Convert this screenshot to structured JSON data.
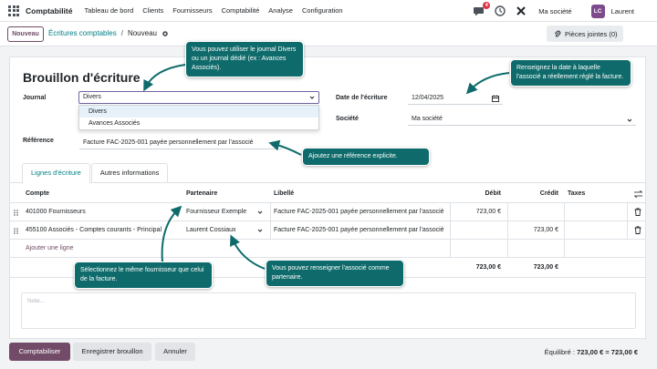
{
  "topbar": {
    "brand": "Comptabilité",
    "menu": [
      "Tableau de bord",
      "Clients",
      "Fournisseurs",
      "Comptabilité",
      "Analyse",
      "Configuration"
    ],
    "chat_badge": "4",
    "company": "Ma société",
    "avatar_initials": "LC",
    "user": "Laurent"
  },
  "control_panel": {
    "new_label": "Nouveau",
    "breadcrumb_parent": "Écritures comptables",
    "breadcrumb_sep": "/",
    "breadcrumb_current": "Nouveau",
    "attachments_label": "Pièces jointes (0)"
  },
  "form": {
    "title": "Brouillon d'écriture",
    "journal_label": "Journal",
    "journal_value": "Divers",
    "journal_options": [
      "Divers",
      "Avances Associés"
    ],
    "date_label": "Date de l'écriture",
    "date_value": "12/04/2025",
    "company_label": "Société",
    "company_value": "Ma société",
    "reference_label": "Référence",
    "reference_value": "Facture FAC-2025-001 payée personnellement par l'associé"
  },
  "tabs": [
    "Lignes d'écriture",
    "Autres informations"
  ],
  "lines": {
    "headers": {
      "account": "Compte",
      "partner": "Partenaire",
      "label": "Libellé",
      "debit": "Débit",
      "credit": "Crédit",
      "taxes": "Taxes"
    },
    "rows": [
      {
        "account": "401000 Fournisseurs",
        "partner": "Fournisseur Exemple",
        "label": "Facture FAC-2025-001 payée personnellement par l'associé",
        "debit": "723,00 €",
        "credit": ""
      },
      {
        "account": "455100 Associés - Comptes courants - Principal",
        "partner": "Laurent Cossiaux",
        "label": "Facture FAC-2025-001 payée personnellement par l'associé",
        "debit": "",
        "credit": "723,00 €"
      }
    ],
    "add_line": "Ajouter une ligne",
    "total_debit": "723,00 €",
    "total_credit": "723,00 €"
  },
  "note_placeholder": "Note...",
  "footer": {
    "post_label": "Comptabiliser",
    "save_draft_label": "Enregistrer brouillon",
    "cancel_label": "Annuler",
    "balance_label": "Équilibré :",
    "balance_value": "723,00 € = 723,00 €"
  },
  "callouts": {
    "journal": "Vous pouvez utiliser le journal Divers ou un journal dédié (ex : Avances Associés).",
    "date": "Renseignez la date à laquelle l'associé a réellement réglé la facture.",
    "reference": "Ajoutez une référence explicite.",
    "supplier": "Sélectionnez le même fournisseur que celui de la facture.",
    "partner": "Vous pouvez renseigner l'associé comme partenaire."
  },
  "colors": {
    "primary": "#714b67",
    "link": "#017e84",
    "callout": "#0f6b6b",
    "badge": "#dc3545"
  }
}
